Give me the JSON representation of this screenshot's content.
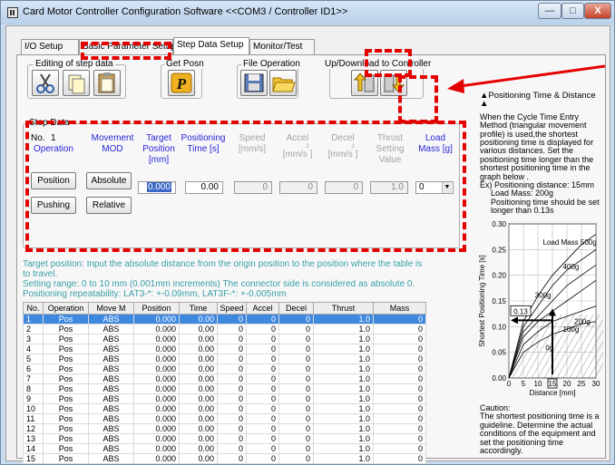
{
  "window": {
    "title": "Card Motor Controller Configuration Software <<COM3 / Controller ID1>>",
    "buttons": {
      "minimize": "—",
      "maximize": "□",
      "close": "X"
    }
  },
  "tabs": [
    "I/O Setup",
    "Basic Parameter Setup",
    "Step Data Setup",
    "Monitor/Test"
  ],
  "toolbar": {
    "editing_label": "Editing of step data",
    "get_posn_label": "Get Posn",
    "file_operation_label": "File Operation",
    "updown_label": "Up/Download to Controller"
  },
  "step_data": {
    "group_label": "Step Data",
    "no_label": "No.",
    "no_value": "1",
    "headers": {
      "operation": "Operation",
      "movement_mod": "Movement MOD",
      "target_position": "Target Position [mm]",
      "positioning_time": "Positioning Time [s]",
      "speed": "Speed [mm/s]",
      "accel_l1": "Accel",
      "accel_l2": "2",
      "accel_l3": "[mm/s ]",
      "decel_l1": "Decel",
      "decel_l2": "2",
      "decel_l3": "[mm/s ]",
      "thrust": "Thrust Setting Value",
      "load_mass": "Load Mass [g]"
    },
    "operation_buttons": [
      "Position",
      "Pushing"
    ],
    "movement_buttons": [
      "Absolute",
      "Relative"
    ],
    "values": {
      "target_position": "0.000",
      "positioning_time": "0.00",
      "speed": "0",
      "accel": "0",
      "decel": "0",
      "thrust": "1.0",
      "load_mass": "0"
    }
  },
  "info_text": [
    "Target position: Input the absolute distance from the origin position to the position where the table is",
    "to travel.",
    "Setting range: 0 to 10 mm (0.001mm increments) The connector side is considered as absolute 0.",
    "Positioning repeatability: LAT3-*: +-0.09mm, LAT3F-*: +-0.005mm"
  ],
  "table": {
    "columns": [
      "No.",
      "Operation",
      "Move M",
      "Position",
      "Time",
      "Speed",
      "Accel",
      "Decel",
      "Thrust",
      "Mass"
    ],
    "rows": [
      [
        "1",
        "Pos",
        "ABS",
        "0.000",
        "0.00",
        "0",
        "0",
        "0",
        "1.0",
        "0"
      ],
      [
        "2",
        "Pos",
        "ABS",
        "0.000",
        "0.00",
        "0",
        "0",
        "0",
        "1.0",
        "0"
      ],
      [
        "3",
        "Pos",
        "ABS",
        "0.000",
        "0.00",
        "0",
        "0",
        "0",
        "1.0",
        "0"
      ],
      [
        "4",
        "Pos",
        "ABS",
        "0.000",
        "0.00",
        "0",
        "0",
        "0",
        "1.0",
        "0"
      ],
      [
        "5",
        "Pos",
        "ABS",
        "0.000",
        "0.00",
        "0",
        "0",
        "0",
        "1.0",
        "0"
      ],
      [
        "6",
        "Pos",
        "ABS",
        "0.000",
        "0.00",
        "0",
        "0",
        "0",
        "1.0",
        "0"
      ],
      [
        "7",
        "Pos",
        "ABS",
        "0.000",
        "0.00",
        "0",
        "0",
        "0",
        "1.0",
        "0"
      ],
      [
        "8",
        "Pos",
        "ABS",
        "0.000",
        "0.00",
        "0",
        "0",
        "0",
        "1.0",
        "0"
      ],
      [
        "9",
        "Pos",
        "ABS",
        "0.000",
        "0.00",
        "0",
        "0",
        "0",
        "1.0",
        "0"
      ],
      [
        "10",
        "Pos",
        "ABS",
        "0.000",
        "0.00",
        "0",
        "0",
        "0",
        "1.0",
        "0"
      ],
      [
        "11",
        "Pos",
        "ABS",
        "0.000",
        "0.00",
        "0",
        "0",
        "0",
        "1.0",
        "0"
      ],
      [
        "12",
        "Pos",
        "ABS",
        "0.000",
        "0.00",
        "0",
        "0",
        "0",
        "1.0",
        "0"
      ],
      [
        "13",
        "Pos",
        "ABS",
        "0.000",
        "0.00",
        "0",
        "0",
        "0",
        "1.0",
        "0"
      ],
      [
        "14",
        "Pos",
        "ABS",
        "0.000",
        "0.00",
        "0",
        "0",
        "0",
        "1.0",
        "0"
      ],
      [
        "15",
        "Pos",
        "ABS",
        "0.000",
        "0.00",
        "0",
        "0",
        "0",
        "1.0",
        "0"
      ]
    ]
  },
  "side_panel": {
    "title": "▲Positioning Time & Distance ▲",
    "intro": "When the Cycle Time Entry Method (triangular movement profile) is used,the shortest positioning time is displayed for various distances. Set the positioning time longer than the shortest positioning time in the graph below .",
    "example_1": "Ex) Positioning distance: 15mm",
    "example_2": "Load Mass: 200g",
    "example_3": "Positioning time should be set longer than 0.13s",
    "caution_label": "Caution:",
    "caution_text": "The shortest positioning time is a guideline. Determine the actual conditions of the equipment and set the positioning time accordingly."
  },
  "chart_data": {
    "type": "line",
    "xlabel": "Distance [mm]",
    "ylabel": "Shortest Positioning Time [s]",
    "xlim": [
      0,
      30
    ],
    "ylim": [
      0,
      0.3
    ],
    "x_ticks": [
      "0",
      "5",
      "10",
      "15",
      "20",
      "25",
      "30"
    ],
    "y_ticks": [
      "0.00",
      "0.05",
      "0.10",
      "0.15",
      "0.20",
      "0.25",
      "0.30"
    ],
    "highlighted_x_tick": "15",
    "annotation_y": "0.13",
    "series_labels": [
      "Load Mass 500g",
      "400g",
      "300g",
      "200g",
      "100g",
      "0g"
    ],
    "series": [
      {
        "name": "Load Mass 500g",
        "x": [
          0,
          5,
          10,
          15,
          20,
          25,
          30
        ],
        "values": [
          0,
          0.11,
          0.16,
          0.2,
          0.23,
          0.26,
          0.28
        ]
      },
      {
        "name": "400g",
        "x": [
          0,
          5,
          10,
          15,
          20,
          25,
          30
        ],
        "values": [
          0,
          0.1,
          0.14,
          0.18,
          0.21,
          0.23,
          0.25
        ]
      },
      {
        "name": "300g",
        "x": [
          0,
          5,
          10,
          15,
          20,
          25,
          30
        ],
        "values": [
          0,
          0.09,
          0.12,
          0.15,
          0.18,
          0.2,
          0.22
        ]
      },
      {
        "name": "200g",
        "x": [
          0,
          5,
          10,
          15,
          20,
          25,
          30
        ],
        "values": [
          0,
          0.08,
          0.11,
          0.13,
          0.15,
          0.17,
          0.19
        ]
      },
      {
        "name": "100g",
        "x": [
          0,
          5,
          10,
          15,
          20,
          25,
          30
        ],
        "values": [
          0,
          0.065,
          0.09,
          0.11,
          0.12,
          0.13,
          0.14
        ]
      },
      {
        "name": "0g",
        "x": [
          0,
          5,
          10,
          15,
          20,
          25,
          30
        ],
        "values": [
          0,
          0.05,
          0.07,
          0.085,
          0.095,
          0.105,
          0.11
        ]
      }
    ]
  },
  "colors": {
    "accent_blue": "#2626d8",
    "info_teal": "#3a9fa8",
    "highlight_red": "#e50000",
    "selection_blue": "#3f88e0"
  }
}
